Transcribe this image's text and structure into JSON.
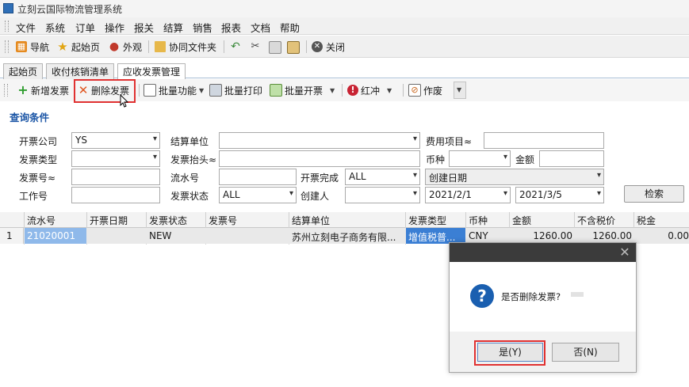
{
  "window": {
    "title": "立刻云国际物流管理系统"
  },
  "menu": [
    "文件",
    "系统",
    "订单",
    "操作",
    "报关",
    "结算",
    "销售",
    "报表",
    "文档",
    "帮助"
  ],
  "toolbar": {
    "nav": "导航",
    "home": "起始页",
    "appearance": "外观",
    "shared_folder": "协同文件夹",
    "close": "关闭"
  },
  "tabs": [
    "起始页",
    "收付核销清单",
    "应收发票管理"
  ],
  "ops": {
    "add": "新增发票",
    "delete": "删除发票",
    "batch": "批量功能",
    "batch_print": "批量打印",
    "batch_issue": "批量开票",
    "red": "红冲",
    "void": "作废"
  },
  "query": {
    "title": "查询条件",
    "labels": {
      "company": "开票公司",
      "settle_unit": "结算单位",
      "fee_item": "费用项目≈",
      "inv_type": "发票类型",
      "inv_head": "发票抬头≈",
      "currency": "币种",
      "amount": "金额",
      "inv_no": "发票号≈",
      "serial": "流水号",
      "issue_done": "开票完成",
      "work_no": "工作号",
      "inv_status": "发票状态",
      "creator": "创建人"
    },
    "values": {
      "company": "YS",
      "issue_done": "ALL",
      "date_type": "创建日期",
      "inv_status": "ALL",
      "date_from": "2021/2/1",
      "date_to": "2021/3/5"
    },
    "search": "检索"
  },
  "grid": {
    "columns": [
      "流水号",
      "开票日期",
      "发票状态",
      "发票号",
      "结算单位",
      "发票类型",
      "币种",
      "金额",
      "不含税价",
      "税金"
    ],
    "rows": [
      {
        "num": "1",
        "serial": "21020001",
        "date": "",
        "status": "NEW",
        "inv_no": "",
        "unit": "苏州立刻电子商务有限...",
        "type": "增值税普...",
        "currency": "CNY",
        "amount": "1260.00",
        "net": "1260.00",
        "tax": "0.00"
      }
    ]
  },
  "dialog": {
    "close": "✕",
    "message": "是否删除发票?",
    "yes": "是(Y)",
    "no": "否(N)"
  }
}
